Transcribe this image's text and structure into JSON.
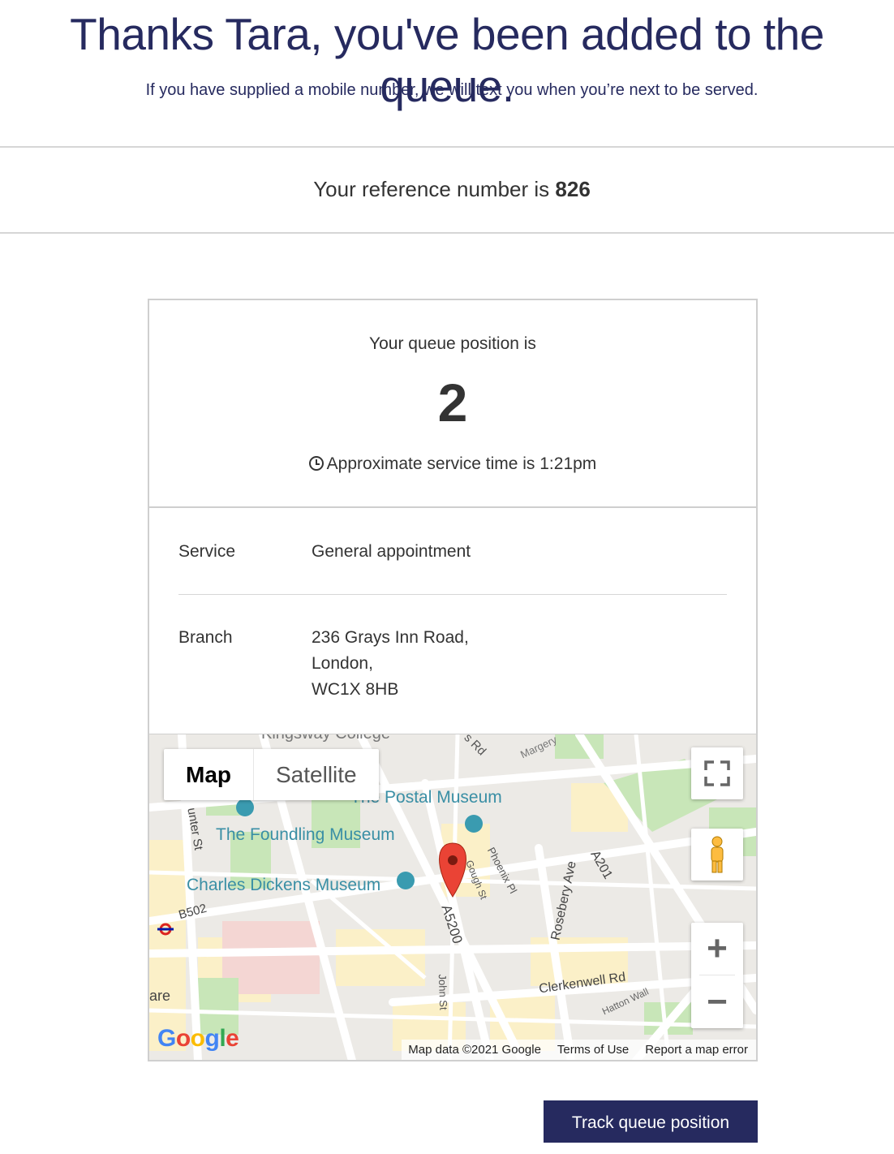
{
  "header": {
    "title": "Thanks Tara, you've been added to the queue.",
    "subtitle": "If you have supplied a mobile number, we will text you when you’re next to be served."
  },
  "reference": {
    "prefix": "Your reference number is",
    "number": "826"
  },
  "queue": {
    "position_label": "Your queue position is",
    "position": "2",
    "service_time": "Approximate service time is 1:21pm"
  },
  "details": {
    "service_label": "Service",
    "service_value": "General appointment",
    "branch_label": "Branch",
    "branch_line1": "236 Grays Inn Road,",
    "branch_line2": "London,",
    "branch_line3": "WC1X 8HB"
  },
  "map": {
    "type_map": "Map",
    "type_satellite": "Satellite",
    "labels": {
      "postal_museum": "The Postal Museum",
      "foundling_museum": "The Foundling Museum",
      "dickens_museum": "Charles Dickens Museum",
      "kingsway": "Kingsway College",
      "margery": "Margery",
      "phoenix": "Phoenix Pl",
      "gough": "Gough St",
      "a5200": "A5200",
      "rosebery": "Rosebery Ave",
      "a201": "A201",
      "b502": "B502",
      "john_st": "John St",
      "clerkenwell": "Clerkenwell Rd",
      "hatton": "Hatton Wall",
      "rd": "s Rd",
      "unter_st": "unter St",
      "are": "are"
    },
    "google": "Google",
    "attribution_data": "Map data ©2021 Google",
    "attribution_terms": "Terms of Use",
    "attribution_report": "Report a map error",
    "zoom_in": "+",
    "zoom_out": "−",
    "colors": {
      "background": "#eceae6",
      "park": "#c8e6b8",
      "road": "#ffffff",
      "yellow_block": "#fbf0c8",
      "pin": "#ea4335",
      "poi_teal": "#3a9bb0"
    }
  },
  "actions": {
    "track_button": "Track queue position"
  }
}
